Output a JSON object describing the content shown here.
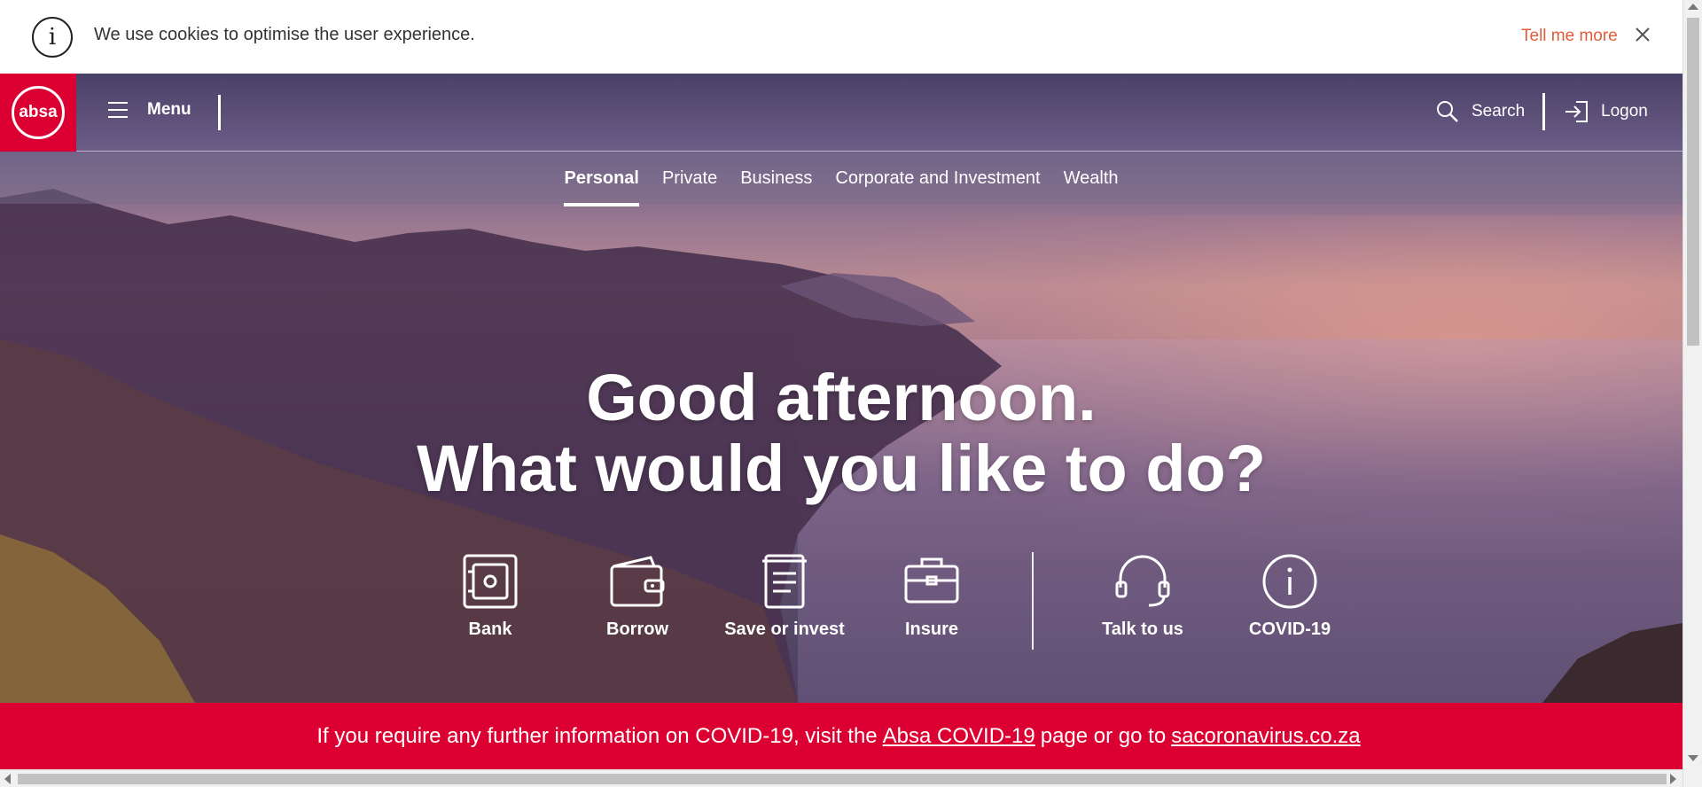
{
  "cookie": {
    "message": "We use cookies to optimise the user experience.",
    "tell_me_more": "Tell me more"
  },
  "header": {
    "logo_text": "absa",
    "menu_label": "Menu",
    "search_label": "Search",
    "logon_label": "Logon"
  },
  "segments": [
    {
      "label": "Personal",
      "active": true
    },
    {
      "label": "Private",
      "active": false
    },
    {
      "label": "Business",
      "active": false
    },
    {
      "label": "Corporate and Investment",
      "active": false
    },
    {
      "label": "Wealth",
      "active": false
    }
  ],
  "hero": {
    "line1": "Good afternoon.",
    "line2": "What would you like to do?"
  },
  "actions": [
    {
      "label": "Bank",
      "icon": "safe-icon"
    },
    {
      "label": "Borrow",
      "icon": "wallet-icon"
    },
    {
      "label": "Save or invest",
      "icon": "document-icon"
    },
    {
      "label": "Insure",
      "icon": "briefcase-icon"
    },
    {
      "label": "Talk to us",
      "icon": "headset-icon"
    },
    {
      "label": "COVID-19",
      "icon": "info-icon"
    }
  ],
  "covid_banner": {
    "prefix": "If you require any further information on COVID-19, visit the",
    "link1": "Absa COVID-19",
    "middle": "page or go to",
    "link2": "sacoronavirus.co.za"
  },
  "colors": {
    "brand_red": "#dc0032",
    "link_orange": "#e05c3a"
  }
}
